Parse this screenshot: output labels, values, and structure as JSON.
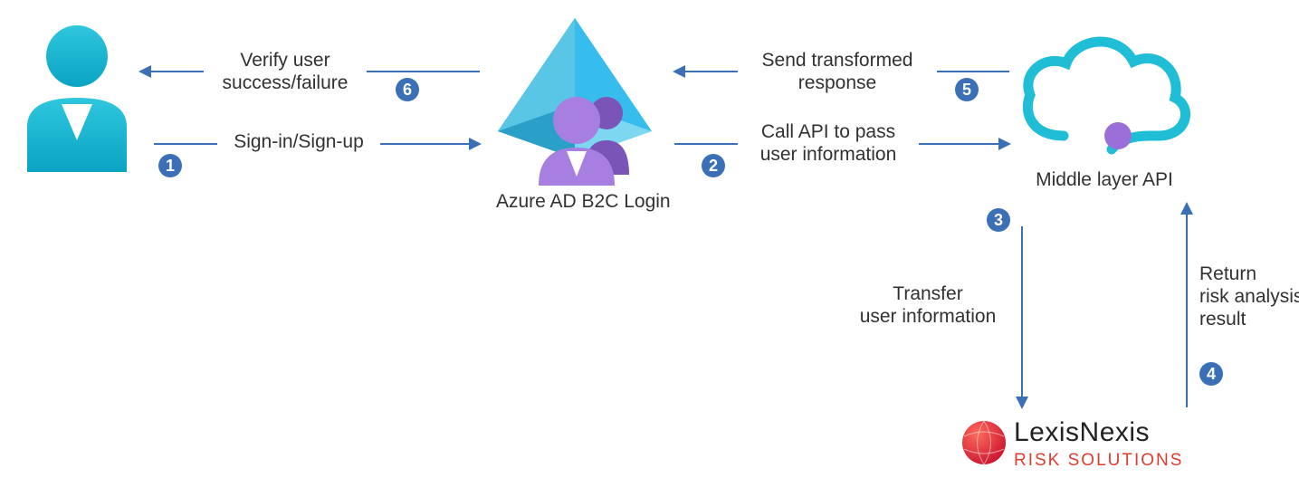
{
  "nodes": {
    "user_label": "",
    "azure_label": "Azure AD B2C Login",
    "api_label": "Middle layer API",
    "lexis_main": "LexisNexis",
    "lexis_sub": "RISK SOLUTIONS"
  },
  "steps": {
    "s1": {
      "num": "1",
      "text": "Sign-in/Sign-up"
    },
    "s2": {
      "num": "2",
      "text": "Call API to pass\nuser information"
    },
    "s3": {
      "num": "3",
      "text": "Transfer\nuser information"
    },
    "s4": {
      "num": "4",
      "text": "Return\nrisk analysis\nresult"
    },
    "s5": {
      "num": "5",
      "text": "Send transformed\nresponse"
    },
    "s6": {
      "num": "6",
      "text": "Verify user\nsuccess/failure"
    }
  },
  "colors": {
    "arrow": "#3b6fb6",
    "badge": "#3b6fb6",
    "user_fill": "#1fbdd6",
    "azure_primary": "#36bdee",
    "azure_dark": "#2aa0c9",
    "person_purple": "#9a6fd8",
    "cloud_stroke": "#1fbdd6",
    "lexis_red": "#e03c31"
  }
}
